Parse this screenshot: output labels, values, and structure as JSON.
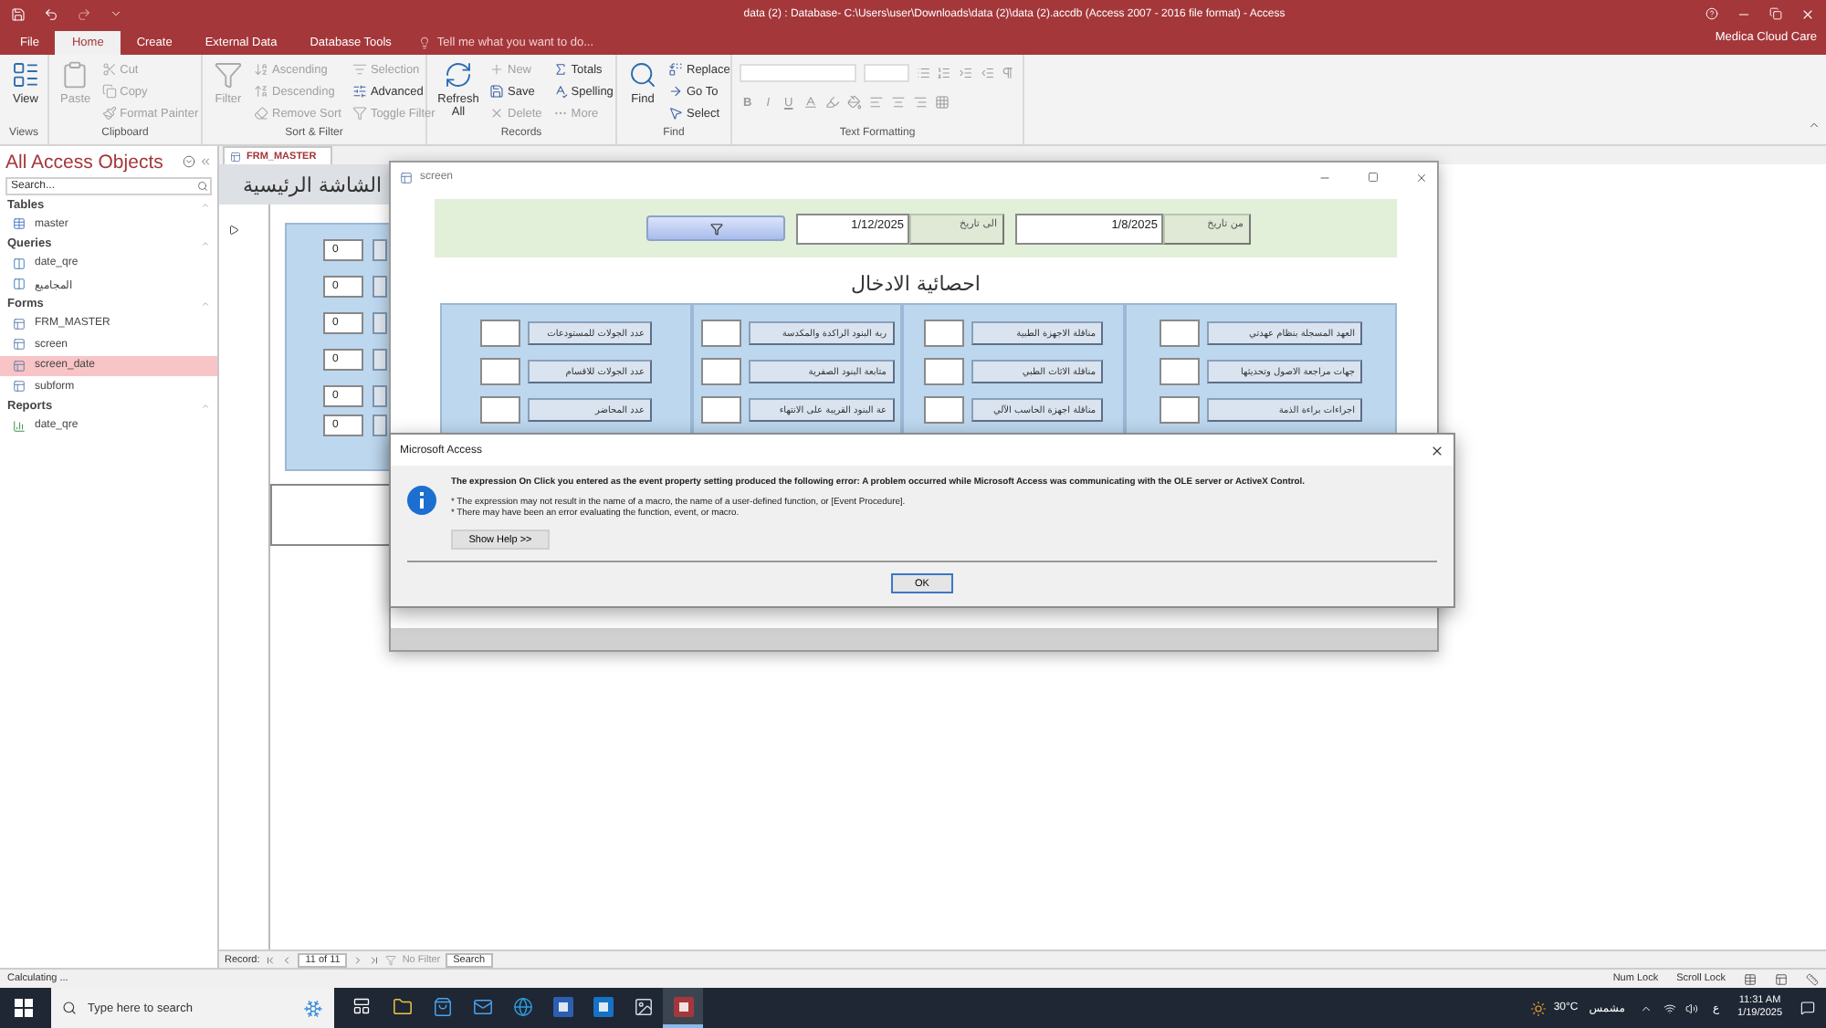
{
  "title_bar": {
    "title": "data (2) : Database- C:\\Users\\user\\Downloads\\data (2)\\data (2).accdb (Access 2007 - 2016 file format) - Access"
  },
  "ribbon": {
    "tabs": [
      {
        "label": "File",
        "selected": false
      },
      {
        "label": "Home",
        "selected": true
      },
      {
        "label": "Create",
        "selected": false
      },
      {
        "label": "External Data",
        "selected": false
      },
      {
        "label": "Database Tools",
        "selected": false
      }
    ],
    "tell_me": "Tell me what you want to do...",
    "account": "Medica Cloud Care",
    "groups": [
      {
        "label": "Views",
        "kind": "commands",
        "items": [
          {
            "label": "View",
            "kind": "large",
            "disabled": false
          }
        ]
      },
      {
        "label": "Clipboard",
        "kind": "commands",
        "items": [
          {
            "label": "Paste",
            "kind": "large",
            "disabled": true
          },
          {
            "label": "Cut",
            "kind": "small",
            "disabled": true
          },
          {
            "label": "Copy",
            "kind": "small",
            "disabled": true
          },
          {
            "label": "Format Painter",
            "kind": "small",
            "disabled": true
          }
        ]
      },
      {
        "label": "Sort & Filter",
        "kind": "commands",
        "items": [
          {
            "label": "Filter",
            "kind": "large",
            "disabled": true
          },
          {
            "label": "Ascending",
            "kind": "small",
            "disabled": true
          },
          {
            "label": "Descending",
            "kind": "small",
            "disabled": true
          },
          {
            "label": "Remove Sort",
            "kind": "small",
            "disabled": true
          },
          {
            "label": "Selection",
            "kind": "small",
            "disabled": true
          },
          {
            "label": "Advanced",
            "kind": "small",
            "disabled": false
          },
          {
            "label": "Toggle Filter",
            "kind": "small",
            "disabled": true
          }
        ]
      },
      {
        "label": "Records",
        "kind": "commands",
        "items": [
          {
            "label": "Refresh All",
            "kind": "large",
            "disabled": false
          },
          {
            "label": "New",
            "kind": "small",
            "disabled": true
          },
          {
            "label": "Save",
            "kind": "small",
            "disabled": false
          },
          {
            "label": "Delete",
            "kind": "small",
            "disabled": true
          },
          {
            "label": "Totals",
            "kind": "small",
            "disabled": false
          },
          {
            "label": "Spelling",
            "kind": "small",
            "disabled": false
          },
          {
            "label": "More",
            "kind": "small",
            "disabled": true
          }
        ]
      },
      {
        "label": "Find",
        "kind": "commands",
        "items": [
          {
            "label": "Find",
            "kind": "large",
            "disabled": false
          },
          {
            "label": "Replace",
            "kind": "small",
            "disabled": false
          },
          {
            "label": "Go To",
            "kind": "small",
            "disabled": false
          },
          {
            "label": "Select",
            "kind": "small",
            "disabled": false
          }
        ]
      },
      {
        "label": "Text Formatting",
        "kind": "formatting",
        "items": [
          {
            "label": "B",
            "disabled": true
          },
          {
            "label": "I",
            "disabled": true
          },
          {
            "label": "U",
            "disabled": true
          }
        ]
      }
    ]
  },
  "navigation_pane": {
    "title": "All Access Objects",
    "search": {
      "placeholder": "Search..."
    },
    "groups": [
      {
        "label": "Tables",
        "kind": "table",
        "items": [
          {
            "label": "master",
            "selected": false
          }
        ]
      },
      {
        "label": "Queries",
        "kind": "query",
        "items": [
          {
            "label": "date_qre",
            "selected": false
          },
          {
            "label": "المجاميع",
            "selected": false
          }
        ]
      },
      {
        "label": "Forms",
        "kind": "form",
        "items": [
          {
            "label": "FRM_MASTER",
            "selected": false
          },
          {
            "label": "screen",
            "selected": false
          },
          {
            "label": "screen_date",
            "selected": true
          },
          {
            "label": "subform",
            "selected": false
          }
        ]
      },
      {
        "label": "Reports",
        "kind": "report",
        "items": [
          {
            "label": "date_qre",
            "selected": false
          }
        ]
      }
    ]
  },
  "document_tab": {
    "label": "FRM_MASTER"
  },
  "main_form": {
    "title": "الشاشة الرئيسية",
    "values": [
      "0",
      "0",
      "0",
      "0",
      "0",
      "0"
    ]
  },
  "screen_window": {
    "title": "screen",
    "from_label": "من تاريخ",
    "from_value": "1/8/2025",
    "to_label": "الى تاريخ",
    "to_value": "1/12/2025",
    "heading": "احصائية الادخال",
    "columns": [
      [
        "العهد المسجلة بنظام عهدتي",
        "جهات مراجعة الاصول وتحديثها",
        "اجراءات براءة الذمة"
      ],
      [
        "مناقلة الاجهزة الطبية",
        "مناقلة الاثاث الطبي",
        "مناقلة اجهزة الحاسب الآلي"
      ],
      [
        "ربة البنود الراكدة والمكدسة",
        "متابعة البنود الصفرية",
        "عة البنود القريبة على الانتهاء"
      ],
      [
        "عدد الجولات للمستودعات",
        "عدد الجولات للاقسام",
        "عدد المحاضر"
      ]
    ]
  },
  "dialog": {
    "title": "Microsoft Access",
    "message": "The expression On Click you entered as the event property setting produced the following error: A problem occurred while Microsoft Access was communicating with the OLE server or ActiveX Control.",
    "notes": [
      "* The expression may not result in the name of a macro, the name of a user-defined function, or [Event Procedure].",
      "* There may have been an error evaluating the function, event, or macro."
    ],
    "help_button": "Show Help >>",
    "ok_button": "OK"
  },
  "record_navigator": {
    "label": "Record:",
    "position": "11 of 11",
    "filter": "No Filter",
    "search": "Search"
  },
  "status_bar": {
    "text": "Calculating ...",
    "indicators": [
      "Num Lock",
      "Scroll Lock"
    ]
  },
  "taskbar": {
    "search_placeholder": "Type here to search",
    "weather": "30°C",
    "weather_text": "مشمس",
    "language": "ع",
    "time": "11:31 AM",
    "date": "1/19/2025",
    "apps": [
      {
        "selected": false
      },
      {
        "selected": false
      },
      {
        "selected": false
      },
      {
        "selected": false
      },
      {
        "selected": false
      },
      {
        "selected": false
      },
      {
        "selected": false
      },
      {
        "selected": false
      },
      {
        "selected": true
      }
    ]
  }
}
